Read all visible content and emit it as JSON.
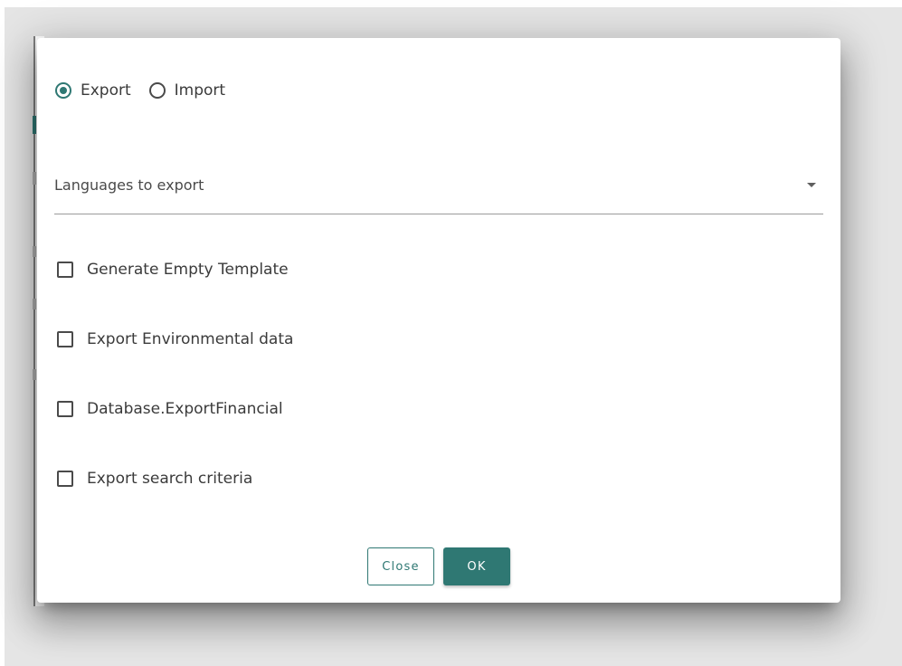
{
  "dialog": {
    "mode_options": [
      {
        "label": "Export",
        "checked": true
      },
      {
        "label": "Import",
        "checked": false
      }
    ],
    "languages_select": {
      "placeholder": "Languages to export"
    },
    "checkboxes": [
      {
        "label": "Generate Empty Template",
        "checked": false
      },
      {
        "label": "Export Environmental data",
        "checked": false
      },
      {
        "label": "Database.ExportFinancial",
        "checked": false
      },
      {
        "label": "Export search criteria",
        "checked": false
      }
    ],
    "buttons": {
      "close_label": "Close",
      "ok_label": "OK"
    }
  },
  "colors": {
    "accent": "#2f7873",
    "backdrop": "#e5e5e5"
  },
  "icons": {
    "dropdown": "caret-down-icon"
  }
}
